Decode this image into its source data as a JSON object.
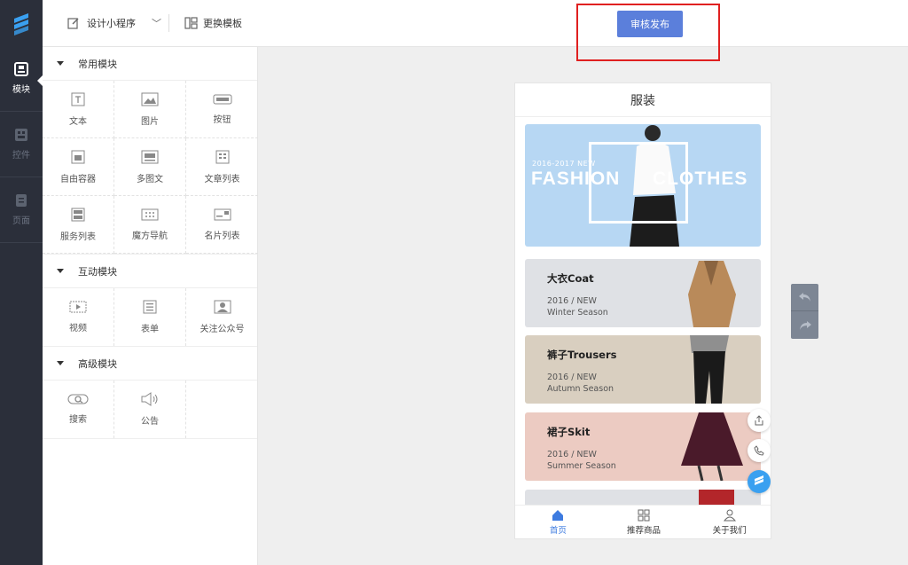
{
  "rail": {
    "items": [
      {
        "label": "模块",
        "icon": "module-icon",
        "active": true
      },
      {
        "label": "控件",
        "icon": "widget-icon",
        "active": false
      },
      {
        "label": "页面",
        "icon": "page-icon",
        "active": false
      }
    ]
  },
  "topbar": {
    "design_label": "设计小程序",
    "template_label": "更换模板",
    "publish_label": "审核发布"
  },
  "panel": {
    "sections": [
      {
        "title": "常用模块",
        "items": [
          "文本",
          "图片",
          "按钮",
          "自由容器",
          "多图文",
          "文章列表",
          "服务列表",
          "魔方导航",
          "名片列表"
        ]
      },
      {
        "title": "互动模块",
        "items": [
          "视频",
          "表单",
          "关注公众号"
        ]
      },
      {
        "title": "高级模块",
        "items": [
          "搜索",
          "公告"
        ]
      }
    ]
  },
  "phone": {
    "title": "服装",
    "banner": {
      "small": "2016-2017 NEW",
      "word1": "FASHION",
      "word2": "CLOTHES"
    },
    "cards": [
      {
        "name": "大衣Coat",
        "line1": "2016 / NEW",
        "line2": "Winter Season",
        "bg": "#dfe1e5"
      },
      {
        "name": "裤子Trousers",
        "line1": "2016 / NEW",
        "line2": "Autumn Season",
        "bg": "#d9cfc0"
      },
      {
        "name": "裙子Skit",
        "line1": "2016 / NEW",
        "line2": "Summer Season",
        "bg": "#eccbc2"
      }
    ],
    "tabs": [
      {
        "label": "首页",
        "active": true
      },
      {
        "label": "推荐商品",
        "active": false
      },
      {
        "label": "关于我们",
        "active": false
      }
    ]
  },
  "colors": {
    "accent": "#5b7fdb",
    "rail": "#2b2f3a",
    "highlight": "#e02020"
  }
}
